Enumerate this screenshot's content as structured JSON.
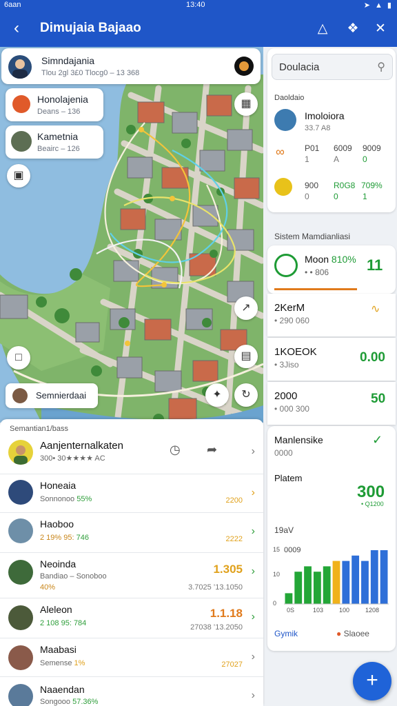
{
  "status": {
    "left": "6aan",
    "time": "13:40",
    "icons": "➤ ▲ ▮"
  },
  "appbar": {
    "title": "Dimujaia Bajaao"
  },
  "map": {
    "top_card": {
      "name": "Simndajania",
      "meta": "Tlou 2gl 3£0  Tlocg0 – 13 368"
    },
    "float_cards": [
      {
        "name": "Honolajenia",
        "meta": "Deans – 136"
      },
      {
        "name": "Kametnia",
        "meta": "Beairc – 126"
      }
    ],
    "bottom_chip": "Semnierdaai"
  },
  "list": {
    "header": "Semantian1/bass",
    "featured": {
      "name": "Aanjenternalkaten",
      "meta": "300• 30★★★★  AC"
    },
    "rows": [
      {
        "name": "Honeaia",
        "sub": "Sonnonoo",
        "pct": "55%",
        "val": "",
        "sm": "2200"
      },
      {
        "name": "Haoboo",
        "sub": "2 19% 95:",
        "pct": "746",
        "val": "",
        "sm": "2222"
      },
      {
        "name": "Neoinda",
        "sub": "Bandiao – Sonoboo",
        "pct": "40%",
        "val": "1.305",
        "sm": "3.7025  ’13.1050"
      },
      {
        "name": "Aleleon",
        "sub": "2 108 95:",
        "pct": "784",
        "val": "1.1.18",
        "sm": "27038  ’13.2050"
      },
      {
        "name": "Maabasi",
        "sub": "Semense",
        "pct": "1%",
        "val": "",
        "sm": "27027"
      },
      {
        "name": "Naaendan",
        "sub": "Songooo",
        "pct": "57.36%",
        "val": "",
        "sm": ""
      }
    ]
  },
  "right": {
    "search": {
      "value": "Doulacia",
      "placeholder": "Doulacia"
    },
    "stats_title": "Daoldaio",
    "profile": {
      "name": "Imoloiora",
      "sub": "33.7 A8"
    },
    "metrics1": [
      "P01",
      "1",
      "6009",
      "A",
      "9009",
      "0"
    ],
    "metrics2": [
      "900",
      "0",
      "R0G8",
      "0",
      "709%",
      "1"
    ],
    "section": "Sistem Mamdianliasi",
    "moon": {
      "label": "Moon",
      "pct": "810%",
      "sub": "• • 806",
      "value": "11"
    },
    "tiles": [
      {
        "title": "2KerM",
        "sub": "• 290 060",
        "value": "∿"
      },
      {
        "title": "1KOEOK",
        "sub": "• 3Jiso",
        "value": "0.00"
      },
      {
        "title": "2000",
        "sub": "• 000 300",
        "value": "50"
      }
    ],
    "chart_card": {
      "title": "Manlensike",
      "sub": "0000",
      "label": "Platem",
      "big_value": "300",
      "big_sub": "• Q1200",
      "y_label": "19aV",
      "axis_note": "0009",
      "footer_left": "Gymik",
      "footer_right": "Slaoee"
    }
  },
  "chart_data": {
    "type": "bar",
    "ylabel": "19aV",
    "x_ticks": [
      "0S",
      "103",
      "100",
      "1208"
    ],
    "y_ticks": [
      "15",
      "10",
      "0"
    ],
    "series": [
      {
        "color": "#23a637",
        "values": [
          2,
          6,
          7,
          6,
          7
        ]
      },
      {
        "color": "#f0b21b",
        "values": [
          8
        ]
      },
      {
        "color": "#2e6fd8",
        "values": [
          8,
          9,
          8,
          10,
          10
        ]
      }
    ]
  }
}
